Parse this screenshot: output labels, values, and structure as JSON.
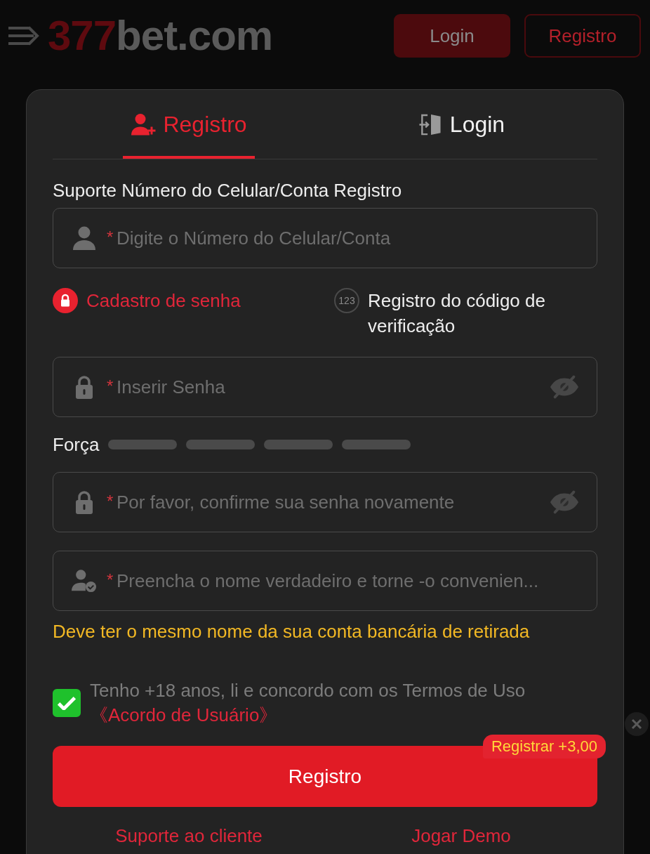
{
  "header": {
    "logo": {
      "prefix": "377",
      "suffix": "bet.com"
    },
    "buttons": [
      {
        "kind": "filled",
        "label": "Login"
      },
      {
        "kind": "outline",
        "label": "Registro"
      }
    ]
  },
  "dialog": {
    "tabs": [
      {
        "kind": "register",
        "label": "Registro",
        "selected": true
      },
      {
        "kind": "login",
        "label": "Login",
        "selected": false
      }
    ],
    "account_label": "Suporte Número do Celular/Conta Registro",
    "account_field": {
      "required_mark": "*",
      "placeholder": "Digite o Número do Celular/Conta"
    },
    "methods": [
      {
        "kind": "password",
        "label": "Cadastro de senha",
        "selected": true
      },
      {
        "kind": "code",
        "icon_text": "123",
        "label": "Registro do código de verificação",
        "selected": false
      }
    ],
    "password_field": {
      "required_mark": "*",
      "placeholder": "Inserir Senha",
      "show_password": false
    },
    "strength": {
      "label": "Força",
      "bars": [
        {
          "filled": false
        },
        {
          "filled": false
        },
        {
          "filled": false
        },
        {
          "filled": false
        }
      ]
    },
    "confirm_field": {
      "required_mark": "*",
      "placeholder": "Por favor, confirme sua senha novamente",
      "show_password": false
    },
    "name_field": {
      "required_mark": "*",
      "placeholder": "Preencha o nome verdadeiro e torne -o convenien..."
    },
    "name_hint": "Deve ter o mesmo nome da sua conta bancária de retirada",
    "agreement": {
      "checked": true,
      "text": "Tenho +18 anos, li e concordo com os Termos de Uso",
      "link": "《Acordo de Usuário》"
    },
    "submit": {
      "label": "Registro",
      "bonus": "Registrar +3,00"
    },
    "footer_links": [
      "Suporte ao cliente",
      "Jogar Demo"
    ]
  }
}
